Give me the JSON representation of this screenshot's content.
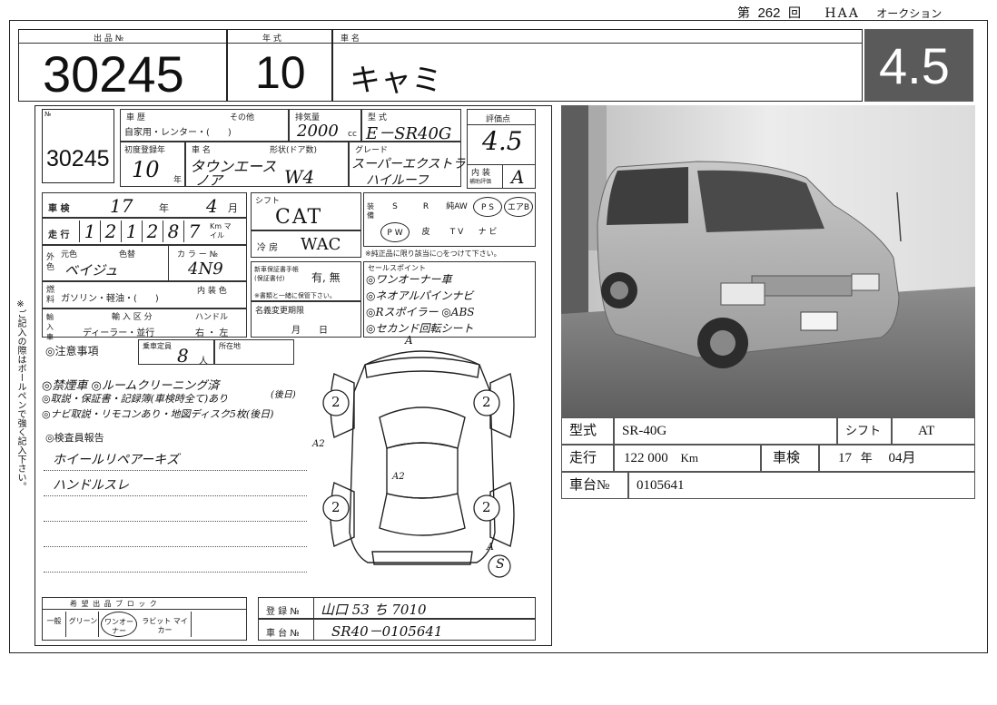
{
  "header": {
    "dai_prefix": "第",
    "session_no": "262",
    "kai_suffix": "回",
    "auction_code": "HAA",
    "auction_word": "オークション"
  },
  "top_row": {
    "lot_label": "出 品 №",
    "lot_no": "30245",
    "year_label": "年 式",
    "year": "10",
    "name_label": "車 名",
    "name": "キャミ",
    "score": "4.5"
  },
  "sheet": {
    "no_label": "№",
    "lot_no": "30245",
    "history_label": "車 歴",
    "history_other": "その他",
    "history_value": "自家用・レンター・(　　)",
    "displacement_label": "排気量",
    "displacement": "2000",
    "cc_unit": "cc",
    "model_label": "型 式",
    "model": "E－SR40G",
    "score_label": "評価点",
    "score": "4.5",
    "interior_label": "内 装",
    "interior_sub": "補助評価",
    "interior_grade": "A",
    "first_reg_label": "初度登録年",
    "first_reg": "10",
    "year_unit": "年",
    "carname_label": "車 名",
    "carname_line1": "タウンエース",
    "carname_line2": "ノア",
    "form_label": "形状(ドア数)",
    "form": "W4",
    "grade_label": "グレード",
    "grade_line1": "スーパーエクストラ",
    "grade_line2": "ハイルーフ",
    "shaken_label": "車 検",
    "shaken_year": "17",
    "shaken_year_unit": "年",
    "shaken_month": "4",
    "shaken_month_unit": "月",
    "mileage_label": "走 行",
    "mileage_digits": [
      "1",
      "2",
      "1",
      "2",
      "8",
      "7"
    ],
    "mileage_unit": "Km マイル",
    "shift_label": "シフト",
    "shift": "CAT",
    "ac_label": "冷 房",
    "ac": "WAC",
    "equip_label": "装備",
    "equip_row1": [
      "S",
      "R",
      "純AW",
      "P S",
      "エアB"
    ],
    "equip_row2": [
      "P W",
      "皮",
      "T V",
      "ナ ビ"
    ],
    "equip_note": "※純正品に限り該当に○をつけて下さい。",
    "color_label": "外色",
    "color_orig_label": "元色",
    "color_change_label": "色替",
    "color": "ベイジュ",
    "colorno_label": "カ ラ ー №",
    "colorno": "4N9",
    "fuel_label": "燃料",
    "fuel_value": "ガソリン・軽油・(　　)",
    "inner_color_label": "内 装 色",
    "import_label": "輸入車",
    "import_sub": "輸 入 区 分",
    "import_value": "ディーラー・並行",
    "handle_label": "ハンドル",
    "handle_value": "右 ・ 左",
    "warranty_label": "新車保証書手帳 (保証書付)",
    "warranty_value": "有, 無",
    "warranty_note": "※書類と一緒に保管下さい。",
    "namechange_label": "名義変更期限",
    "namechange_value": "月　　日",
    "sales_label": "セールスポイント",
    "sales_points": [
      "◎ワンオーナー車",
      "◎ネオアルパインナビ",
      "◎Rスポイラー ◎ABS",
      "◎セカンド回転シート"
    ],
    "caution_label": "◎注意事項",
    "capacity_label": "乗車定員",
    "capacity": "8",
    "capacity_unit": "人",
    "location_label": "所在地",
    "notes": [
      "◎禁煙車 ◎ルームクリーニング済",
      "◎取説・保証書・記録簿(車検時全て)あり",
      "◎ナビ取説・リモコンあり・地図ディスク5枚(後日)"
    ],
    "notes_aside": "(後日)",
    "inspector_label": "◎検査員報告",
    "inspector_notes": [
      "ホイールリペアーキズ",
      "ハンドルスレ"
    ],
    "block_label": "希 望 出 品 ブ ロ ッ ク",
    "block_items": [
      "一般",
      "グリーン",
      "ワンオーナー",
      "ラビット マイカー"
    ],
    "reg_label": "登 録 №",
    "reg_value": "山口 53 ち 7010",
    "chassis_label": "車 台 №",
    "chassis_value": "SR40－0105641",
    "side_note": "※ご記入の際はボールペンで強く記入下さい。",
    "diagram_marks": [
      "2",
      "2",
      "2",
      "2"
    ],
    "diagram_a_marks": [
      "A",
      "A2",
      "A2",
      "A",
      "S"
    ]
  },
  "spec": {
    "model_label": "型式",
    "model": "SR-40G",
    "shift_label": "シフト",
    "shift": "AT",
    "mileage_label": "走行",
    "mileage": "122 000",
    "mileage_unit": "Km",
    "shaken_label": "車検",
    "shaken_year": "17",
    "shaken_year_unit": "年",
    "shaken_month": "04月",
    "chassis_label": "車台№",
    "chassis": "0105641"
  },
  "colors": {
    "score_bg": "#5a5a5a",
    "score_fg": "#ffffff",
    "ink": "#111111"
  }
}
